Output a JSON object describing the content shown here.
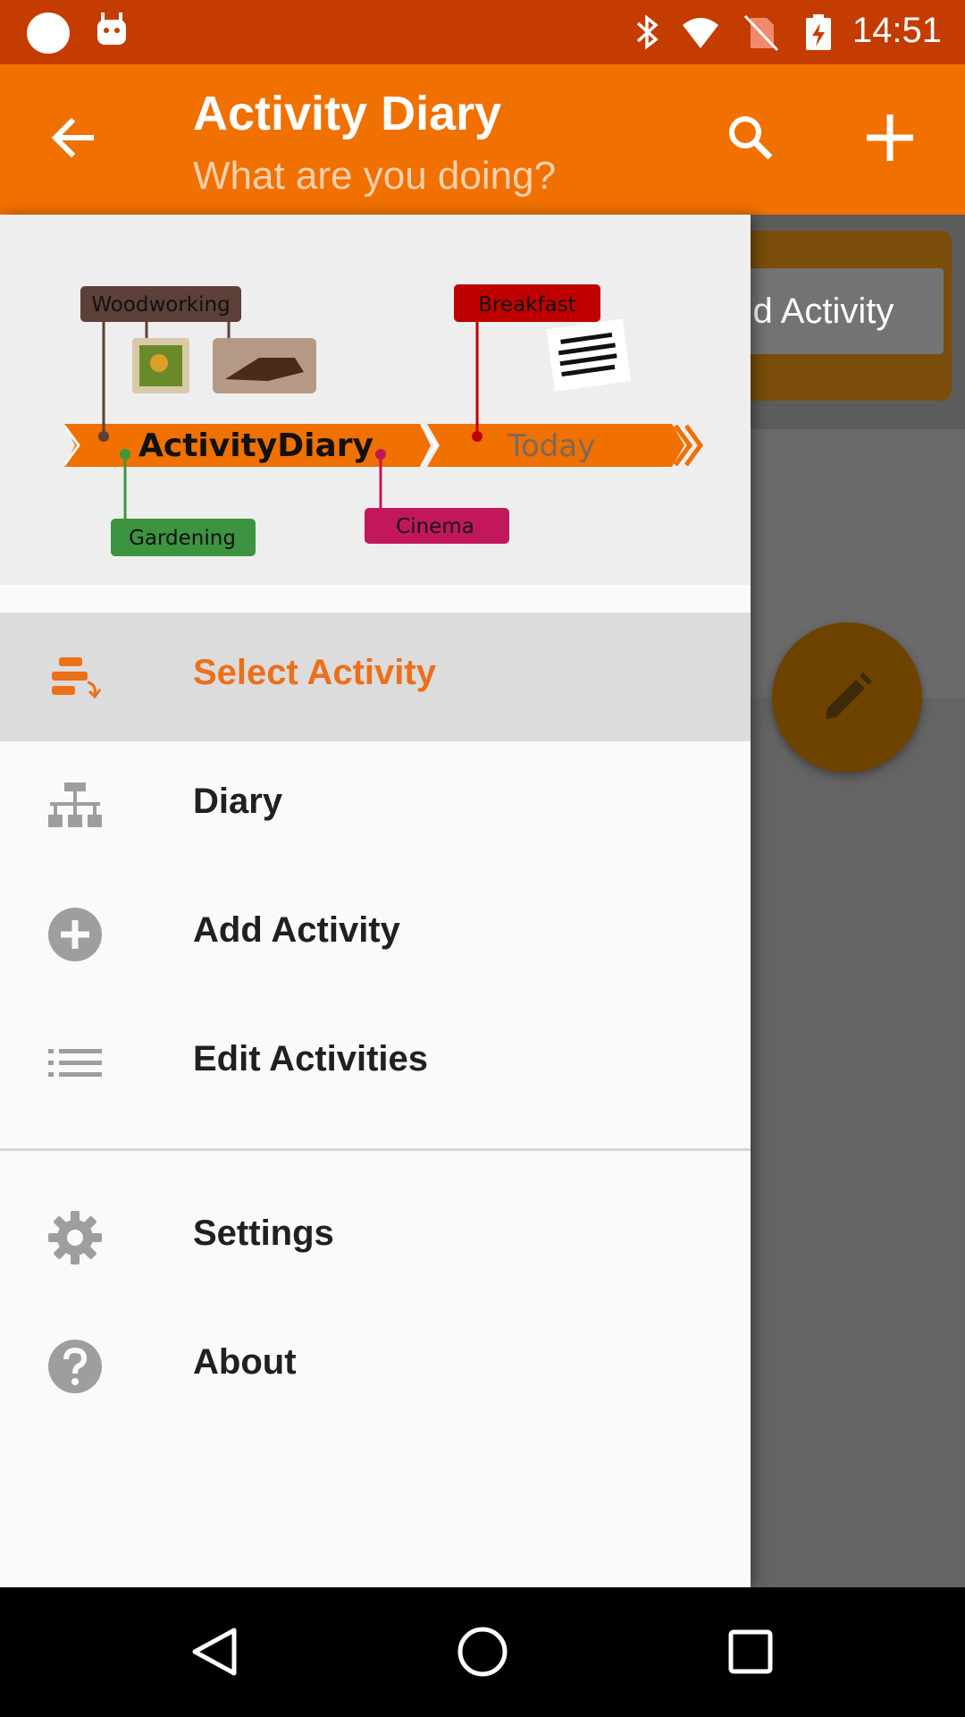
{
  "status_bar": {
    "time": "14:51"
  },
  "app_bar": {
    "title": "Activity Diary",
    "subtitle": "What are you doing?"
  },
  "tooltip": {
    "text": "Add Activity"
  },
  "drawer": {
    "header": {
      "brand": "ActivityDiary",
      "today": "Today",
      "tags": {
        "woodworking": "Woodworking",
        "breakfast": "Breakfast",
        "gardening": "Gardening",
        "cinema": "Cinema"
      }
    },
    "items": [
      {
        "label": "Select Activity",
        "icon": "select-activity-icon",
        "active": true
      },
      {
        "label": "Diary",
        "icon": "diary-icon"
      },
      {
        "label": "Add Activity",
        "icon": "add-circle-icon"
      },
      {
        "label": "Edit Activities",
        "icon": "list-icon"
      },
      {
        "label": "Settings",
        "icon": "gear-icon"
      },
      {
        "label": "About",
        "icon": "help-icon"
      }
    ]
  },
  "colors": {
    "status_bar": "#c43c00",
    "app_bar": "#f07000",
    "accent": "#ee6f1a",
    "timeline": "#f07000"
  }
}
